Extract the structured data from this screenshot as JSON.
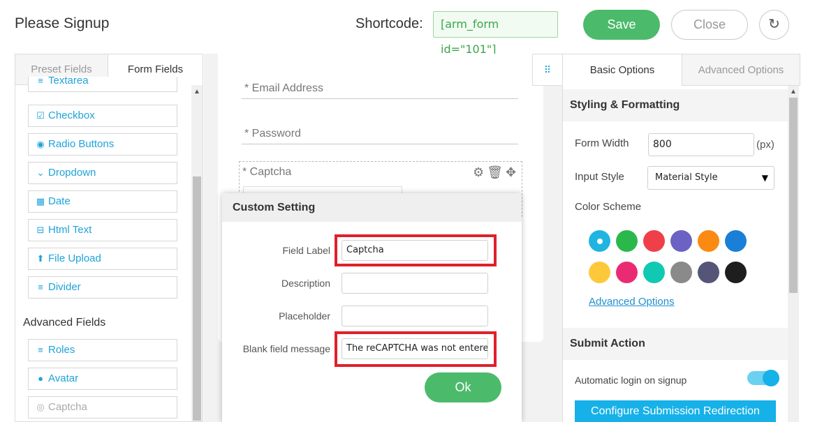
{
  "header": {
    "title": "Please Signup",
    "shortcode_label": "Shortcode:",
    "shortcode_value": "[arm_form id=\"101\"]",
    "save_label": "Save",
    "close_label": "Close",
    "reset_icon": "↻"
  },
  "left": {
    "tabs": [
      {
        "label": "Preset Fields"
      },
      {
        "label": "Form Fields"
      }
    ],
    "fields": [
      {
        "icon": "≡",
        "label": "Textarea"
      },
      {
        "icon": "☑",
        "label": "Checkbox"
      },
      {
        "icon": "◉",
        "label": "Radio Buttons"
      },
      {
        "icon": "⌄",
        "label": "Dropdown"
      },
      {
        "icon": "▦",
        "label": "Date"
      },
      {
        "icon": "⊟",
        "label": "Html Text"
      },
      {
        "icon": "⬆",
        "label": "File Upload"
      },
      {
        "icon": "≡",
        "label": "Divider"
      }
    ],
    "advanced_heading": "Advanced Fields",
    "advanced_fields": [
      {
        "icon": "≡",
        "label": "Roles"
      },
      {
        "icon": "●",
        "label": "Avatar"
      },
      {
        "icon": "◎",
        "label": "Captcha"
      }
    ]
  },
  "center": {
    "email_label": "* Email Address",
    "password_label": "* Password",
    "captcha_label": "* Captcha",
    "field_icons": "⚙🗑✥"
  },
  "popup": {
    "title": "Custom Setting",
    "field_label_label": "Field Label",
    "field_label_value": "Captcha",
    "description_label": "Description",
    "description_value": "",
    "placeholder_label": "Placeholder",
    "placeholder_value": "",
    "blank_msg_label": "Blank field message",
    "blank_msg_value": "The reCAPTCHA was not entered correctly",
    "ok_label": "Ok"
  },
  "right": {
    "handle_icon": "⠿",
    "tabs": [
      {
        "label": "Basic Options"
      },
      {
        "label": "Advanced Options"
      }
    ],
    "styling_heading": "Styling & Formatting",
    "form_width_label": "Form Width",
    "form_width_value": "800",
    "form_width_unit": "(px)",
    "input_style_label": "Input Style",
    "input_style_value": "Material Style",
    "color_scheme_label": "Color Scheme",
    "colors": [
      "#1fb5e0",
      "#2bb84a",
      "#ef4049",
      "#6b62c4",
      "#fa8a12",
      "#1a7fd6",
      "#fdc93a",
      "#ea2b74",
      "#10c9b2",
      "#8a8a8a",
      "#555577",
      "#1e1e1e"
    ],
    "advanced_options_link": "Advanced Options",
    "submit_heading": "Submit Action",
    "auto_login_label": "Automatic login on signup",
    "auto_login_on": true,
    "redirect_button": "Configure Submission Redirection"
  }
}
